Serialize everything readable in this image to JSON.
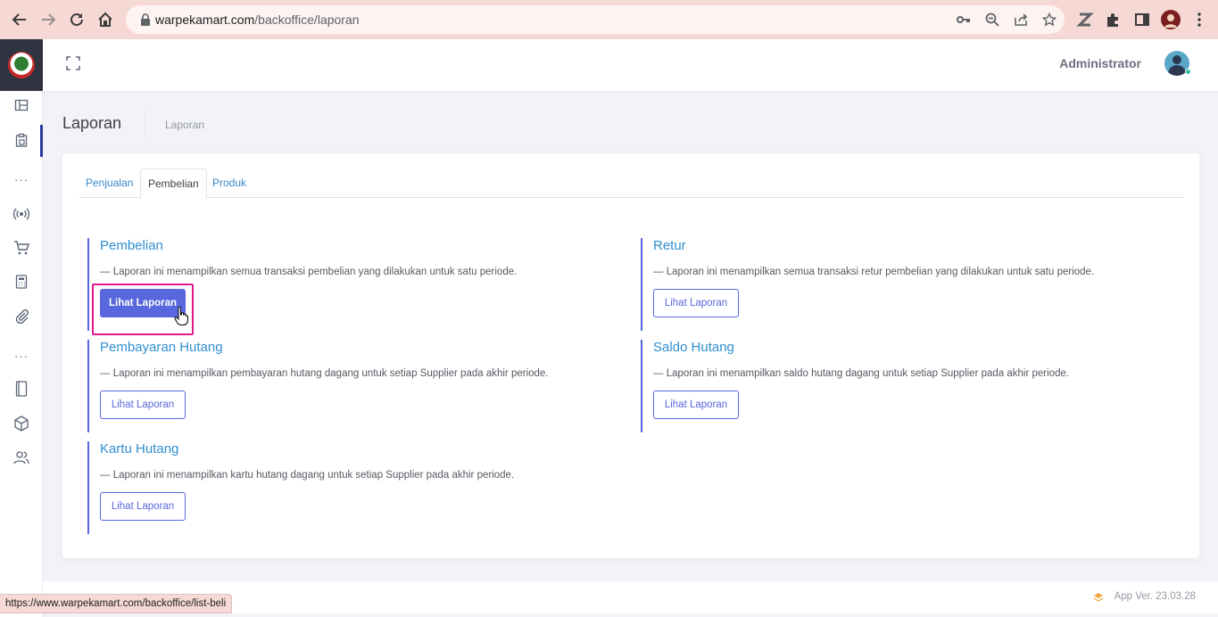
{
  "browser": {
    "url_host": "warpekamart.com",
    "url_path": "/backoffice/laporan",
    "status_url": "https://www.warpekamart.com/backoffice/list-beli"
  },
  "header": {
    "admin_name": "Administrator"
  },
  "subheader": {
    "title": "Laporan",
    "breadcrumb": "Laporan"
  },
  "tabs": [
    {
      "label": "Penjualan",
      "active": false
    },
    {
      "label": "Pembelian",
      "active": true
    },
    {
      "label": "Produk",
      "active": false
    }
  ],
  "sections": [
    {
      "title": "Pembelian",
      "description": "— Laporan ini menampilkan semua transaksi pembelian yang dilakukan untuk satu periode.",
      "button": "Lihat Laporan",
      "highlighted": true
    },
    {
      "title": "Retur",
      "description": "— Laporan ini menampilkan semua transaksi retur pembelian yang dilakukan untuk satu periode.",
      "button": "Lihat Laporan"
    },
    {
      "title": "Pembayaran Hutang",
      "description": "— Laporan ini menampilkan pembayaran hutang dagang untuk setiap Supplier pada akhir periode.",
      "button": "Lihat Laporan"
    },
    {
      "title": "Saldo Hutang",
      "description": "— Laporan ini menampilkan saldo hutang dagang untuk setiap Supplier pada akhir periode.",
      "button": "Lihat Laporan"
    },
    {
      "title": "Kartu Hutang",
      "description": "— Laporan ini menampilkan kartu hutang dagang untuk setiap Supplier pada akhir periode.",
      "button": "Lihat Laporan"
    }
  ],
  "footer": {
    "version": "App Ver. 23.03.28"
  },
  "colors": {
    "accent": "#5867dd",
    "link": "#2f8fd0",
    "highlight": "#e0198b",
    "browser_bar": "#f6d9d4"
  },
  "sidebar": {
    "icons": [
      "dashboard-icon",
      "clipboard-icon",
      "more-dots",
      "broadcast-icon",
      "cart-icon",
      "calculator-icon",
      "paperclip-icon",
      "more-dots",
      "book-icon",
      "box-icon",
      "users-icon"
    ]
  }
}
